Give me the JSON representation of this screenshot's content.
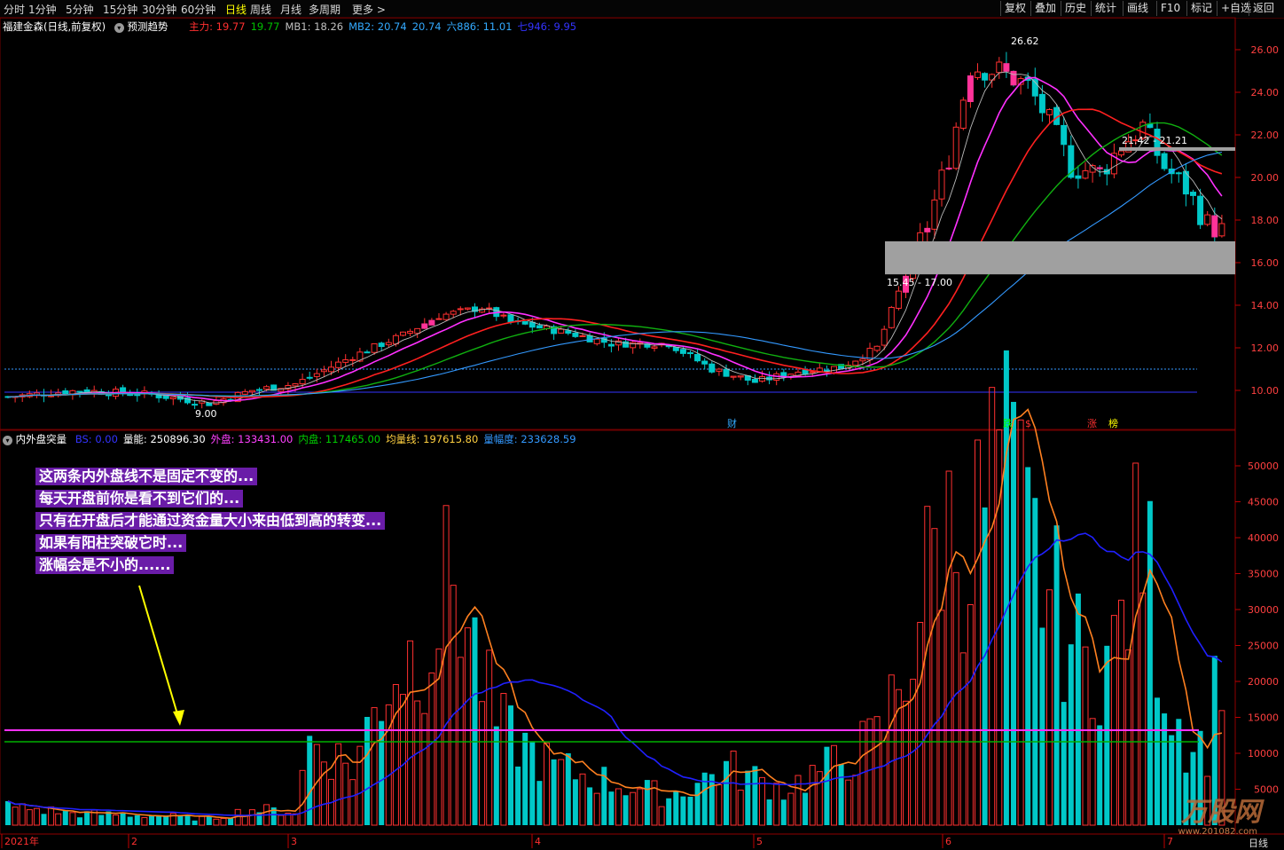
{
  "toolbar": {
    "periods": [
      "分时",
      "1分钟",
      "5分钟",
      "15分钟",
      "30分钟",
      "60分钟",
      "日线",
      "周线",
      "月线",
      "多周期",
      "更多"
    ],
    "active_period": "日线",
    "right_buttons": [
      "复权",
      "叠加",
      "历史",
      "统计",
      "画线",
      "F10",
      "标记",
      "+自选",
      "返回"
    ]
  },
  "main_legend": {
    "stock": "福建金森(日线,前复权)",
    "predict": "预测趋势",
    "items": [
      {
        "label": "主力: ",
        "value": "19.77",
        "color": "#ff3030"
      },
      {
        "label": "",
        "value": "19.77",
        "color": "#00c000"
      },
      {
        "label": "MB1: ",
        "value": "18.26",
        "color": "#c0c0c0"
      },
      {
        "label": "MB2: ",
        "value": "20.74",
        "color": "#33aaff"
      },
      {
        "label": "",
        "value": "20.74",
        "color": "#33aaff"
      },
      {
        "label": "六886: ",
        "value": "11.01",
        "color": "#33aaff"
      },
      {
        "label": "七946: ",
        "value": "9.95",
        "color": "#3333ff"
      }
    ]
  },
  "sub_legend": {
    "name": "内外盘突量",
    "items": [
      {
        "label": "BS: ",
        "value": "0.00",
        "color": "#3333ff"
      },
      {
        "label": "量能: ",
        "value": "250896.30",
        "color": "#ffffff"
      },
      {
        "label": "外盘: ",
        "value": "133431.00",
        "color": "#ff40ff"
      },
      {
        "label": "内盘: ",
        "value": "117465.00",
        "color": "#00cc00"
      },
      {
        "label": "均量线: ",
        "value": "197615.80",
        "color": "#ffd040"
      },
      {
        "label": "量幅度: ",
        "value": "233628.59",
        "color": "#3399ff"
      }
    ]
  },
  "price_axis": [
    "26.00",
    "24.00",
    "22.00",
    "20.00",
    "18.00",
    "16.00",
    "14.00",
    "12.00",
    "10.00"
  ],
  "volume_axis": [
    "50000",
    "45000",
    "40000",
    "35000",
    "30000",
    "25000",
    "20000",
    "15000",
    "10000",
    "5000"
  ],
  "x_labels": [
    "2021年",
    "2",
    "3",
    "4",
    "5",
    "6",
    "7"
  ],
  "annotations": {
    "high": "26.62",
    "low": "9.00",
    "zone_low": "15.45 - 17.00",
    "zone_high": "21.42 - 21.21",
    "event_cai": "财",
    "event_die": "跌",
    "event_s": "$",
    "event_zhang": "涨",
    "event_bang": "榜"
  },
  "note_lines": [
    "这两条内外盘线不是固定不变的...",
    "每天开盘前你是看不到它们的...",
    "只有在开盘后才能通过资金量大小来由低到高的转变...",
    "如果有阳柱突破它时...",
    "涨幅会是不小的......"
  ],
  "watermark": {
    "brand": "万股网",
    "url": "www.201082.com",
    "corner": "日线"
  },
  "colors": {
    "up": "#ff3030",
    "down": "#00c8c8",
    "limit_up": "#ff3399",
    "ma_magenta": "#ff30ff",
    "ma_red": "#ff2020",
    "ma_green": "#10b010",
    "ma_blue": "#3399ff"
  }
}
